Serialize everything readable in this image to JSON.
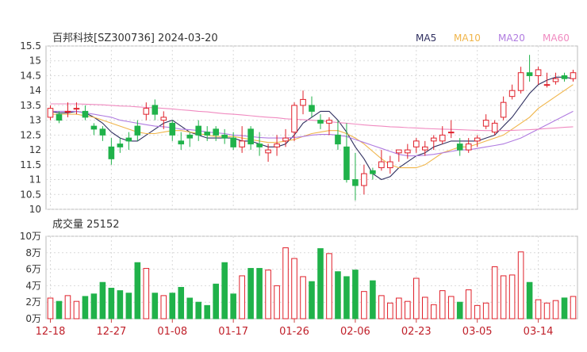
{
  "header": {
    "title": "百邦科技[SZ300736] 2024-03-20",
    "ma_labels": [
      {
        "text": "MA5",
        "color": "#2f2f5f"
      },
      {
        "text": "MA10",
        "color": "#f0b54a"
      },
      {
        "text": "MA20",
        "color": "#b07be0"
      },
      {
        "text": "MA60",
        "color": "#f08ac0"
      }
    ]
  },
  "volume_header": {
    "label": "成交量",
    "value": "25152"
  },
  "colors": {
    "up": "#e0202a",
    "down": "#20b24a",
    "grid": "#d9d9d9",
    "axis": "#333333"
  },
  "chart_data": [
    {
      "type": "candlestick",
      "ylim": [
        10,
        15.5
      ],
      "yticks": [
        "10",
        "10.5",
        "11",
        "11.5",
        "12",
        "12.5",
        "13",
        "13.5",
        "14",
        "14.5",
        "15",
        "15.5"
      ],
      "dates": [
        "12-18",
        "12-19",
        "12-20",
        "12-21",
        "12-22",
        "12-25",
        "12-26",
        "12-27",
        "12-28",
        "12-29",
        "01-02",
        "01-03",
        "01-04",
        "01-05",
        "01-08",
        "01-09",
        "01-10",
        "01-11",
        "01-12",
        "01-15",
        "01-16",
        "01-17",
        "01-18",
        "01-19",
        "01-22",
        "01-23",
        "01-24",
        "01-25",
        "01-26",
        "01-29",
        "01-30",
        "01-31",
        "02-01",
        "02-02",
        "02-05",
        "02-06",
        "02-07",
        "02-08",
        "02-19",
        "02-20",
        "02-21",
        "02-22",
        "02-23",
        "02-26",
        "02-27",
        "02-28",
        "02-29",
        "03-01",
        "03-04",
        "03-05",
        "03-06",
        "03-07",
        "03-08",
        "03-11",
        "03-12",
        "03-13",
        "03-14",
        "03-15",
        "03-18",
        "03-19",
        "03-20"
      ],
      "open": [
        13.1,
        13.2,
        13.3,
        13.4,
        13.3,
        12.8,
        12.7,
        12.1,
        12.2,
        12.4,
        12.8,
        13.2,
        13.5,
        13.0,
        12.9,
        12.3,
        12.5,
        12.8,
        12.6,
        12.7,
        12.5,
        12.4,
        12.1,
        12.7,
        12.2,
        11.9,
        12.1,
        12.3,
        12.6,
        13.5,
        13.5,
        13.0,
        12.9,
        12.5,
        12.1,
        11.0,
        10.8,
        11.3,
        11.4,
        11.4,
        11.9,
        11.9,
        12.1,
        12.0,
        12.3,
        12.3,
        12.6,
        12.2,
        12.0,
        12.3,
        12.8,
        12.6,
        13.1,
        13.8,
        14.0,
        14.6,
        14.5,
        14.2,
        14.3,
        14.5,
        14.4
      ],
      "close": [
        13.4,
        13.0,
        13.3,
        13.4,
        13.1,
        12.7,
        12.5,
        11.7,
        12.1,
        12.3,
        12.5,
        13.4,
        13.2,
        13.1,
        12.5,
        12.2,
        12.4,
        12.5,
        12.5,
        12.5,
        12.4,
        12.1,
        12.3,
        12.2,
        12.1,
        12.0,
        12.2,
        12.4,
        13.5,
        13.7,
        13.3,
        12.9,
        13.0,
        12.2,
        11.0,
        10.8,
        11.2,
        11.2,
        11.6,
        11.6,
        12.0,
        12.0,
        12.3,
        12.1,
        12.4,
        12.5,
        12.6,
        12.0,
        12.2,
        12.4,
        13.0,
        12.9,
        13.6,
        14.0,
        14.6,
        14.5,
        14.7,
        14.2,
        14.4,
        14.4,
        14.6
      ],
      "high": [
        13.5,
        13.3,
        13.6,
        13.6,
        13.5,
        12.9,
        12.8,
        12.4,
        12.4,
        12.6,
        13.0,
        13.6,
        13.7,
        13.3,
        13.0,
        12.6,
        12.6,
        13.0,
        12.8,
        12.8,
        12.7,
        12.6,
        12.8,
        12.8,
        12.6,
        12.2,
        12.5,
        12.7,
        13.6,
        14.0,
        13.8,
        13.2,
        13.1,
        13.0,
        12.9,
        11.9,
        11.5,
        11.4,
        12.0,
        11.8,
        12.0,
        12.2,
        12.4,
        12.3,
        12.5,
        12.8,
        13.0,
        12.4,
        12.4,
        12.5,
        13.2,
        13.0,
        13.8,
        14.2,
        14.8,
        15.2,
        14.8,
        14.6,
        14.6,
        14.6,
        14.7
      ],
      "low": [
        13.0,
        12.9,
        13.1,
        13.2,
        13.0,
        12.5,
        12.3,
        11.5,
        11.9,
        12.0,
        12.3,
        13.0,
        13.0,
        12.7,
        12.3,
        12.0,
        12.1,
        12.3,
        12.3,
        12.3,
        12.2,
        12.0,
        11.9,
        12.0,
        11.8,
        11.6,
        11.8,
        12.1,
        12.3,
        13.2,
        13.1,
        12.7,
        12.5,
        12.0,
        10.9,
        10.3,
        10.5,
        11.0,
        11.3,
        11.2,
        11.6,
        11.7,
        11.9,
        11.8,
        12.0,
        12.2,
        12.4,
        11.8,
        11.9,
        12.1,
        12.7,
        12.5,
        13.0,
        13.7,
        13.9,
        14.3,
        14.2,
        14.1,
        14.2,
        14.3,
        14.3
      ],
      "ma5": [
        13.3,
        13.25,
        13.25,
        13.3,
        13.25,
        13.1,
        12.9,
        12.6,
        12.4,
        12.3,
        12.3,
        12.5,
        12.7,
        12.9,
        13.0,
        12.8,
        12.6,
        12.5,
        12.4,
        12.4,
        12.4,
        12.4,
        12.3,
        12.3,
        12.2,
        12.1,
        12.1,
        12.2,
        12.5,
        12.9,
        13.1,
        13.3,
        13.3,
        13.0,
        12.6,
        12.1,
        11.7,
        11.2,
        11.0,
        11.1,
        11.4,
        11.6,
        11.8,
        11.9,
        12.1,
        12.2,
        12.3,
        12.3,
        12.3,
        12.3,
        12.4,
        12.5,
        12.8,
        13.1,
        13.5,
        13.9,
        14.2,
        14.35,
        14.45,
        14.45,
        14.4
      ],
      "ma10": [
        13.2,
        13.2,
        13.2,
        13.2,
        13.15,
        13.1,
        13.0,
        12.9,
        12.8,
        12.7,
        12.6,
        12.55,
        12.55,
        12.6,
        12.65,
        12.65,
        12.6,
        12.55,
        12.5,
        12.45,
        12.45,
        12.45,
        12.4,
        12.35,
        12.3,
        12.25,
        12.25,
        12.3,
        12.35,
        12.45,
        12.55,
        12.6,
        12.65,
        12.65,
        12.55,
        12.4,
        12.2,
        11.95,
        11.7,
        11.5,
        11.4,
        11.4,
        11.4,
        11.5,
        11.7,
        11.9,
        12.0,
        12.1,
        12.1,
        12.2,
        12.3,
        12.4,
        12.5,
        12.7,
        12.9,
        13.1,
        13.4,
        13.6,
        13.8,
        14.0,
        14.2
      ],
      "ma20": [
        13.3,
        13.3,
        13.3,
        13.3,
        13.25,
        13.2,
        13.15,
        13.1,
        13.0,
        12.95,
        12.9,
        12.85,
        12.8,
        12.78,
        12.75,
        12.7,
        12.68,
        12.65,
        12.6,
        12.58,
        12.55,
        12.5,
        12.48,
        12.45,
        12.42,
        12.4,
        12.4,
        12.4,
        12.42,
        12.45,
        12.5,
        12.52,
        12.52,
        12.5,
        12.45,
        12.35,
        12.25,
        12.15,
        12.05,
        11.95,
        11.85,
        11.8,
        11.8,
        11.82,
        11.85,
        11.9,
        11.95,
        12.0,
        12.0,
        12.05,
        12.1,
        12.15,
        12.2,
        12.3,
        12.4,
        12.55,
        12.7,
        12.85,
        13.0,
        13.15,
        13.3
      ],
      "ma60": [
        13.55,
        13.55,
        13.55,
        13.55,
        13.54,
        13.53,
        13.52,
        13.5,
        13.48,
        13.47,
        13.45,
        13.43,
        13.42,
        13.4,
        13.38,
        13.35,
        13.33,
        13.3,
        13.28,
        13.25,
        13.22,
        13.2,
        13.18,
        13.15,
        13.12,
        13.1,
        13.08,
        13.05,
        13.03,
        13.02,
        13.0,
        12.98,
        12.95,
        12.92,
        12.9,
        12.87,
        12.84,
        12.82,
        12.8,
        12.78,
        12.77,
        12.75,
        12.74,
        12.72,
        12.71,
        12.7,
        12.69,
        12.68,
        12.67,
        12.66,
        12.65,
        12.65,
        12.65,
        12.66,
        12.67,
        12.68,
        12.7,
        12.72,
        12.74,
        12.76,
        12.78
      ],
      "xticks": [
        "12-18",
        "12-27",
        "01-08",
        "01-17",
        "01-26",
        "02-06",
        "02-23",
        "03-05",
        "03-14"
      ]
    },
    {
      "type": "bar",
      "title": "成交量",
      "ylim": [
        0,
        100000
      ],
      "yticks": [
        "0万",
        "2万",
        "4万",
        "6万",
        "8万",
        "10万"
      ],
      "values": [
        25000,
        21000,
        28000,
        21000,
        27000,
        30000,
        44000,
        37000,
        34000,
        31000,
        68000,
        61000,
        31000,
        28000,
        31000,
        38000,
        25000,
        20000,
        16000,
        42000,
        68000,
        30000,
        52000,
        61000,
        61000,
        59000,
        40000,
        86000,
        73000,
        51000,
        45000,
        85000,
        79000,
        57000,
        51000,
        59000,
        33000,
        46000,
        28000,
        19000,
        25000,
        21000,
        49000,
        26000,
        17000,
        34000,
        27000,
        20000,
        35000,
        16000,
        19000,
        63000,
        52000,
        53000,
        81000,
        44000,
        23000,
        19000,
        22000,
        25152,
        27000
      ]
    }
  ]
}
